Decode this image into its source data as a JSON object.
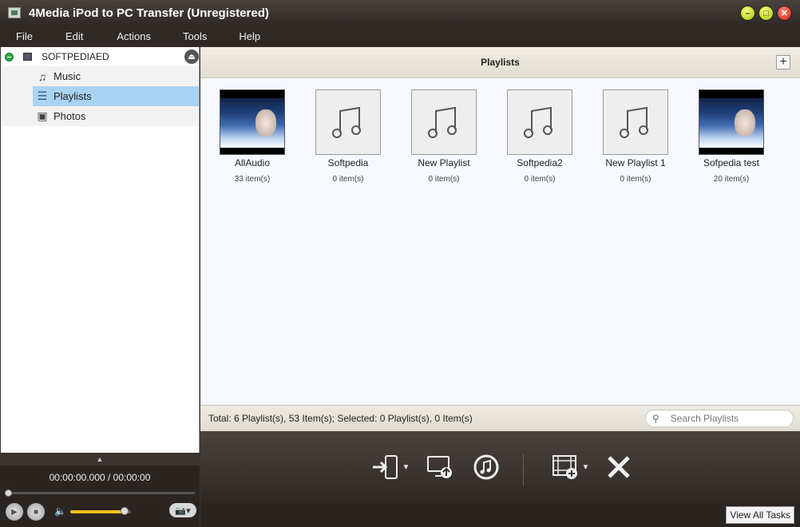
{
  "window": {
    "title": "4Media iPod to PC Transfer (Unregistered)",
    "controls": [
      "minimize",
      "maximize",
      "close"
    ]
  },
  "menu": [
    "File",
    "Edit",
    "Actions",
    "Tools",
    "Help"
  ],
  "sidebar": {
    "device": "SOFTPEDIAED",
    "items": [
      {
        "label": "Music",
        "icon": "music-note-icon",
        "selected": false
      },
      {
        "label": "Playlists",
        "icon": "playlist-icon",
        "selected": true
      },
      {
        "label": "Photos",
        "icon": "photo-icon",
        "selected": false
      }
    ]
  },
  "player": {
    "time": "00:00:00.000 / 00:00:00",
    "seek_position": 0,
    "volume": 0.9
  },
  "content": {
    "title": "Playlists",
    "playlists": [
      {
        "name": "AllAudio",
        "count": "33 item(s)",
        "thumb": "photo"
      },
      {
        "name": "Softpedia",
        "count": "0 item(s)",
        "thumb": "music"
      },
      {
        "name": "New Playlist",
        "count": "0 item(s)",
        "thumb": "music"
      },
      {
        "name": "Softpedia2",
        "count": "0 item(s)",
        "thumb": "music"
      },
      {
        "name": "New Playlist 1",
        "count": "0 item(s)",
        "thumb": "music"
      },
      {
        "name": "Sofpedia test",
        "count": "20 item(s)",
        "thumb": "photo"
      }
    ]
  },
  "status": {
    "text": "Total: 6 Playlist(s), 53 Item(s); Selected: 0 Playlist(s), 0 Item(s)",
    "search_placeholder": "Search Playlists"
  },
  "toolbar": {
    "buttons": [
      "import-to-device-icon",
      "export-to-pc-icon",
      "export-to-itunes-icon",
      "add-video-icon",
      "delete-icon"
    ]
  },
  "tasks": {
    "view_all_label": "View All Tasks"
  }
}
